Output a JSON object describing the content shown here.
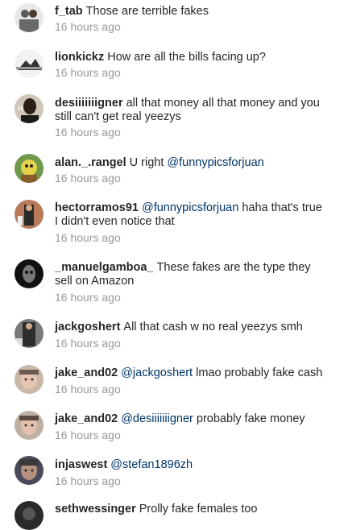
{
  "comments": [
    {
      "username": "f_tab",
      "text": "Those are terrible fakes",
      "time": "16 hours ago"
    },
    {
      "username": "lionkickz",
      "text": "How are all the bills facing up?",
      "time": "16 hours ago"
    },
    {
      "username": "desiiiiiiigner",
      "text": "all that money all that money and you still can't get real yeezys",
      "time": "16 hours ago"
    },
    {
      "username": "alan._.rangel",
      "text": "U right",
      "mention": "@funnypicsforjuan",
      "time": "16 hours ago"
    },
    {
      "username": "hectorramos91",
      "mention": "@funnypicsforjuan",
      "text": "haha that's true I didn't even notice that",
      "time": "16 hours ago"
    },
    {
      "username": "_manuelgamboa_",
      "text": "These fakes are the type they sell on Amazon",
      "time": "16 hours ago"
    },
    {
      "username": "jackgoshert",
      "text": "All that cash w no real yeezys smh",
      "time": "16 hours ago"
    },
    {
      "username": "jake_and02",
      "mention": "@jackgoshert",
      "text": "lmao probably fake cash",
      "time": "16 hours ago"
    },
    {
      "username": "jake_and02",
      "mention": "@desiiiiiiigner",
      "text": "probably fake money",
      "time": "16 hours ago"
    },
    {
      "username": "injaswest",
      "mention": "@stefan1896zh",
      "text": "",
      "time": "16 hours ago"
    },
    {
      "username": "sethwessinger",
      "text": "Prolly fake females too",
      "time": ""
    }
  ],
  "avatar_colors": [
    "#5a5a5a",
    "#b9b9b9",
    "#3a3226",
    "#4f7a3a",
    "#8a4a3a",
    "#1a1a1a",
    "#3b3b3b",
    "#9b7e6e",
    "#8a7a70",
    "#4a4a5a",
    "#2a2a2a"
  ]
}
